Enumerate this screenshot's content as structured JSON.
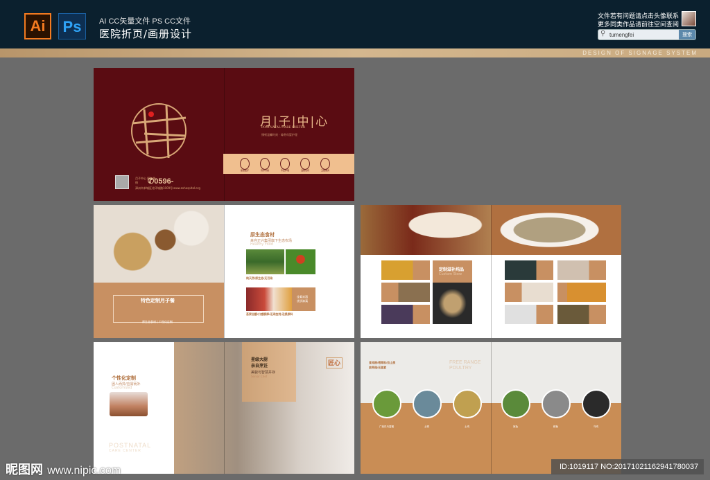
{
  "header": {
    "ai_logo": "Ai",
    "ps_logo": "Ps",
    "subtitle": "AI CC矢量文件  PS CC文件",
    "title": "医院折页/画册设计",
    "notice_line1": "文件若有问题请点击头像联系",
    "notice_line2": "更多同类作品请前往空间查阅",
    "search_value": "tumengfei",
    "search_button": "搜索"
  },
  "banner": {
    "text": "DESIGN OF SIGNAGE SYSTEM"
  },
  "cover": {
    "title": "月|子|中|心",
    "subtitle_en": "POSTNATAL CARE CNETER",
    "tagline": "臻顿温馨时刻 · 尊贵母婴护理",
    "phone": "✆0596-",
    "address": "漳州市芗城区北环城路1009号",
    "website": "www.zxhospital.org",
    "hotline_label": "月子中心 服务热线",
    "services": [
      "星级医疗",
      "营养月餐",
      "专业护理",
      "温馨住所",
      "五星服务"
    ]
  },
  "spread2": {
    "feature_title": "特色定制月子餐",
    "feature_footer": "原生态食材 | 个性化定制",
    "eco_title": "原生态食材",
    "eco_sub": "来自正兴集团旗下生态农场",
    "eco_en": "Healthy Food",
    "eco_caption": "纯天然/原生态/无污染",
    "badge": "佳肴米酒 优质淋漓",
    "bottom_caption": "吾家自酿/口感醇厚/无添加剂/无损原料"
  },
  "spread3": {
    "title": "定制滋补炖品",
    "title_en": "Custom Stew"
  },
  "spread4": {
    "custom_title": "个性化定制",
    "custom_sub": "因人而异/应需而补",
    "custom_en": "Customized",
    "brand_en1": "POSTNATAL",
    "brand_en2": "CARE CENTER",
    "chef_title1": "星级大厨",
    "chef_title2": "亲自烹饪",
    "chef_sub": "美貌与智慧并存",
    "chef_en": "Senior Chef",
    "seal": "匠心"
  },
  "spread5": {
    "heading1": "食纯粮/喂草料/饮山泉",
    "heading2": "放养园/无激素",
    "heading_en1": "FREE RANGE",
    "heading_en2": "POULTRY",
    "animals": [
      "广西巴马香猪",
      "土鸭",
      "土鸡",
      "家兔",
      "鲜鱼",
      "乌鸡"
    ]
  },
  "watermark": {
    "logo": "昵图网",
    "url": "www.nipic.com",
    "id": "ID:1019117 NO:20171021162941780037"
  }
}
